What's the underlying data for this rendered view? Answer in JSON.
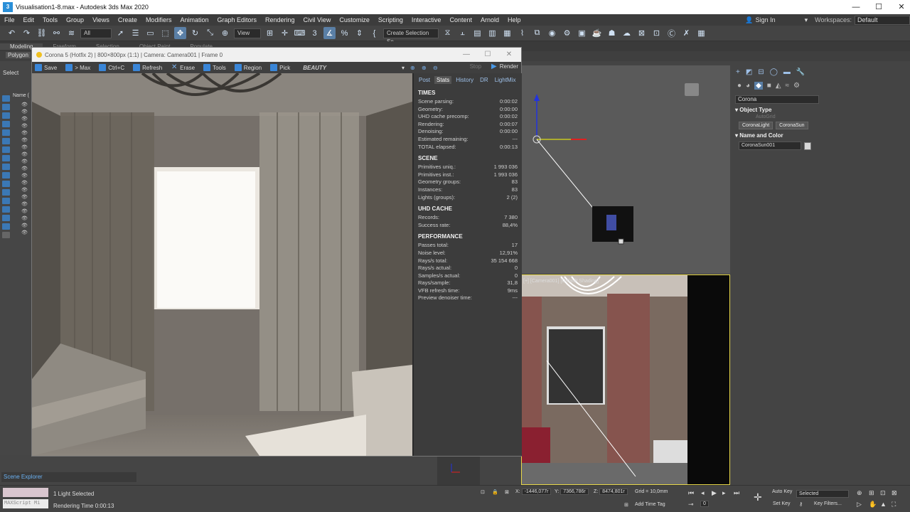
{
  "window": {
    "title": "Visualisation1-8.max - Autodesk 3ds Max 2020",
    "min": "—",
    "max": "☐",
    "close": "✕"
  },
  "menu": [
    "File",
    "Edit",
    "Tools",
    "Group",
    "Views",
    "Create",
    "Modifiers",
    "Animation",
    "Graph Editors",
    "Rendering",
    "Civil View",
    "Customize",
    "Scripting",
    "Interactive",
    "Content",
    "Arnold",
    "Help"
  ],
  "account": {
    "signin": "Sign In",
    "workspaces_label": "Workspaces:",
    "workspace": "Default"
  },
  "toolbar": {
    "filter": "All",
    "refcoord": "View",
    "selset": "Create Selection Se"
  },
  "ribbon": {
    "tabs": [
      "Modeling",
      "Freeform",
      "Selection",
      "Object Paint",
      "Populate"
    ],
    "polygon": "Polygon"
  },
  "left": {
    "select": "Select",
    "name": "Name ("
  },
  "vfb": {
    "title": "Corona 5 (Hotfix 2) | 800×800px (1:1) | Camera: Camera001 | Frame 0",
    "tools": [
      "Save",
      "> Max",
      "Ctrl+C",
      "Refresh",
      "Erase",
      "Tools",
      "Region",
      "Pick"
    ],
    "beauty": "BEAUTY",
    "stop": "Stop",
    "render": "Render",
    "stats_tabs": [
      "Post",
      "Stats",
      "History",
      "DR",
      "LightMix"
    ],
    "sections": [
      {
        "title": "TIMES",
        "rows": [
          [
            "Scene parsing:",
            "0:00:02"
          ],
          [
            "Geometry:",
            "0:00:00"
          ],
          [
            "UHD cache precomp:",
            "0:00:02"
          ],
          [
            "Rendering:",
            "0:00:07"
          ],
          [
            "Denoising:",
            "0:00:00"
          ],
          [
            "Estimated remaining:",
            "---"
          ],
          [
            "TOTAL elapsed:",
            "0:00:13"
          ]
        ]
      },
      {
        "title": "SCENE",
        "rows": [
          [
            "Primitives uniq.:",
            "1 993 036"
          ],
          [
            "Primitives inst.:",
            "1 993 036"
          ],
          [
            "Geometry groups:",
            "83"
          ],
          [
            "Instances:",
            "83"
          ],
          [
            "Lights (groups):",
            "2 (2)"
          ]
        ]
      },
      {
        "title": "UHD CACHE",
        "rows": [
          [
            "Records:",
            "7 380"
          ],
          [
            "Success rate:",
            "88,4%"
          ]
        ]
      },
      {
        "title": "PERFORMANCE",
        "rows": [
          [
            "Passes total:",
            "17"
          ],
          [
            "Noise level:",
            "12,91%"
          ],
          [
            "Rays/s total:",
            "35 154 668"
          ],
          [
            "Rays/s actual:",
            "0"
          ],
          [
            "Samples/s actual:",
            "0"
          ],
          [
            "Rays/sample:",
            "31,8"
          ],
          [
            "VFB refresh time:",
            "9ms"
          ],
          [
            "Preview denoiser time:",
            "---"
          ]
        ]
      }
    ]
  },
  "viewport": {
    "persp_label": "[+] [Camera001] [Default Shading]"
  },
  "cmd": {
    "category": "Corona",
    "object_type": "Object Type",
    "autogrid": "AutoGrid",
    "buttons": [
      "CoronaLight",
      "CoronaSun"
    ],
    "name_color": "Name and Color",
    "name": "CoronaSun001",
    "swatch_color": "#d8d8d8"
  },
  "status": {
    "scene_explorer": "Scene Explorer",
    "maxscript": "MAXScript Mi",
    "selected": "1 Light Selected",
    "render_time": "Rendering Time 0:00:13",
    "x": "-1446,077r",
    "y": "7366,786r",
    "z": "8474,801r",
    "grid": "Grid = 10,0mm",
    "add_time_tag": "Add Time Tag",
    "auto_key": "Auto Key",
    "set_key": "Set Key",
    "selected_drop": "Selected",
    "key_filters": "Key Filters...",
    "frame": "0"
  }
}
